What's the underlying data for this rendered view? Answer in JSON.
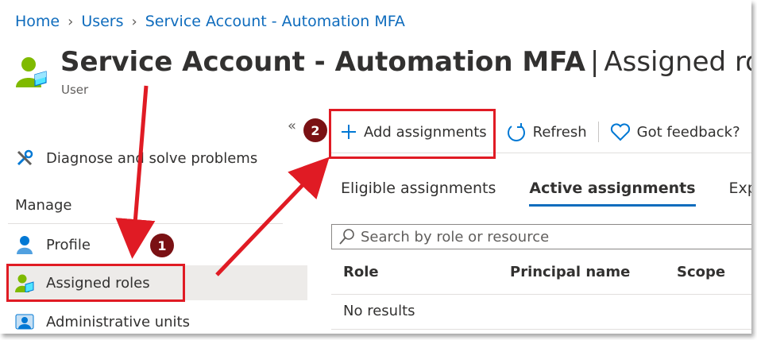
{
  "breadcrumb": {
    "home": "Home",
    "users": "Users",
    "account": "Service Account - Automation MFA"
  },
  "header": {
    "title_main": "Service Account - Automation MFA",
    "title_pipe": "|",
    "title_section": "Assigned roles",
    "subtitle": "User"
  },
  "sidebar": {
    "collapse_glyph": "«",
    "diagnose": "Diagnose and solve problems",
    "section": "Manage",
    "items": [
      {
        "label": "Profile",
        "icon": "profile-icon"
      },
      {
        "label": "Assigned roles",
        "icon": "assigned-roles-icon",
        "selected": true
      },
      {
        "label": "Administrative units",
        "icon": "administrative-units-icon"
      }
    ]
  },
  "toolbar": {
    "add": "Add assignments",
    "refresh": "Refresh",
    "feedback": "Got feedback?"
  },
  "tabs": [
    "Eligible assignments",
    "Active assignments",
    "Expired"
  ],
  "active_tab": "Active assignments",
  "search": {
    "placeholder": "Search by role or resource",
    "value": ""
  },
  "table": {
    "headers": [
      "Role",
      "Principal name",
      "Scope"
    ],
    "empty_text": "No results"
  },
  "annotations": {
    "badge1": "1",
    "badge2": "2",
    "color": "#e01b24",
    "badge_color": "#7a1114"
  }
}
